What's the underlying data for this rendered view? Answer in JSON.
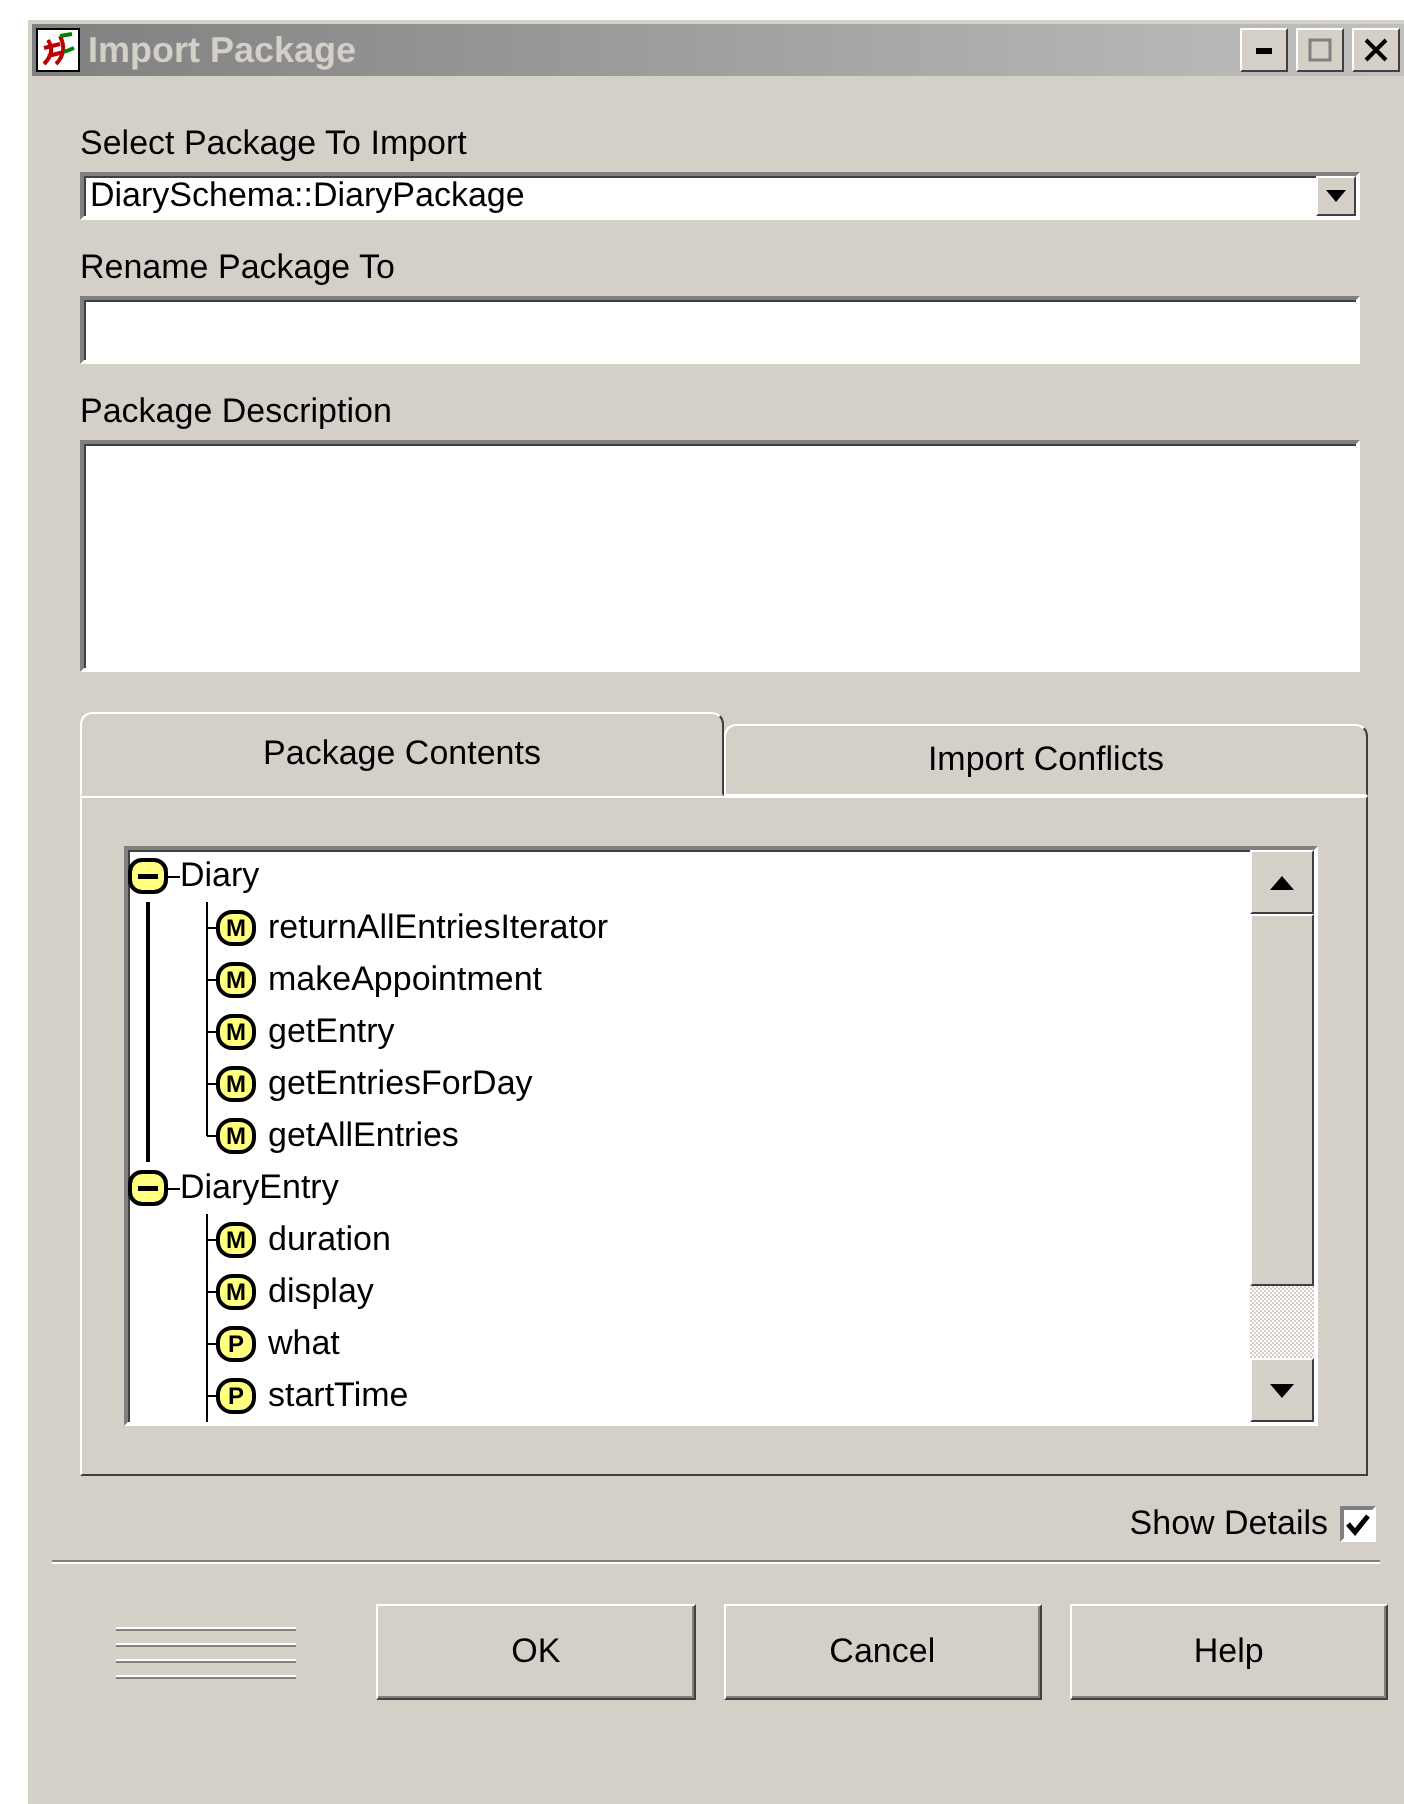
{
  "window": {
    "title": "Import Package"
  },
  "select_package": {
    "label": "Select Package To Import",
    "value": "DiarySchema::DiaryPackage"
  },
  "rename": {
    "label": "Rename Package To"
  },
  "description": {
    "label": "Package Description"
  },
  "tabs": [
    {
      "label": "Package Contents",
      "selected": true
    },
    {
      "label": "Import Conflicts",
      "selected": false
    }
  ],
  "tree": [
    {
      "label": "Diary",
      "expanded": true,
      "continues": false,
      "children": [
        {
          "badge": "M",
          "label": "returnAllEntriesIterator"
        },
        {
          "badge": "M",
          "label": "makeAppointment"
        },
        {
          "badge": "M",
          "label": "getEntry"
        },
        {
          "badge": "M",
          "label": "getEntriesForDay"
        },
        {
          "badge": "M",
          "label": "getAllEntries"
        }
      ]
    },
    {
      "label": "DiaryEntry",
      "expanded": true,
      "continues": true,
      "children": [
        {
          "badge": "M",
          "label": "duration"
        },
        {
          "badge": "M",
          "label": "display"
        },
        {
          "badge": "P",
          "label": "what"
        },
        {
          "badge": "P",
          "label": "startTime"
        }
      ]
    }
  ],
  "show_details": {
    "label": "Show Details",
    "checked": true
  },
  "buttons": [
    {
      "label": "OK"
    },
    {
      "label": "Cancel"
    },
    {
      "label": "Help"
    }
  ]
}
